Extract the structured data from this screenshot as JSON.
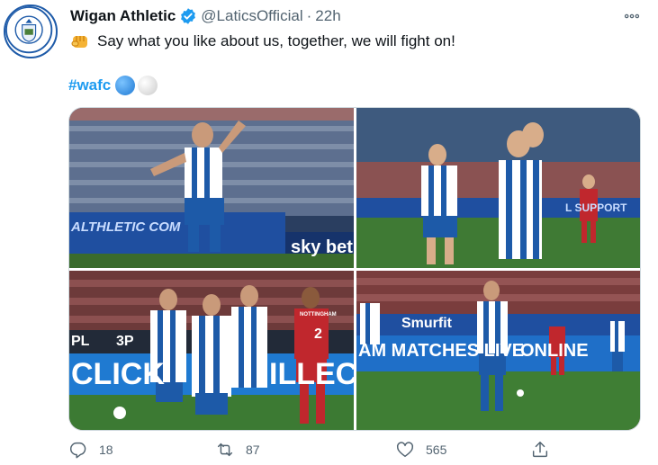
{
  "tweet": {
    "display_name": "Wigan Athletic",
    "handle": "@LaticsOfficial",
    "separator": "·",
    "timestamp": "22h",
    "text": "Say what you like about us, together, we will fight on!",
    "hashtag": "#wafc",
    "emojis": [
      "blue-circle",
      "white-circle"
    ],
    "avatar_badge": {
      "top_text": "WIGAN",
      "bottom_text": "ATHLETIC"
    },
    "photos": [
      {
        "board_text": "ALTHLETIC COM",
        "sponsor_text": "sky bet"
      },
      {
        "board_text": "L SUPPORT"
      },
      {
        "board_text": "CLICK",
        "board_text_2": "ILLECT",
        "board_text_3": "PL",
        "board_text_4": "3P",
        "shirt_number": "2",
        "shirt_sponsor": "NOTTINGHAM"
      },
      {
        "board_text": "AM MATCHES LIVE",
        "board_text_2": "ONLINE",
        "sponsor_text": "Smurfit"
      }
    ]
  },
  "actions": {
    "replies": "18",
    "retweets": "87",
    "likes": "565"
  },
  "colors": {
    "accent": "#1d9bf0",
    "wigan_blue": "#1d5aa8",
    "muted": "#536471"
  }
}
